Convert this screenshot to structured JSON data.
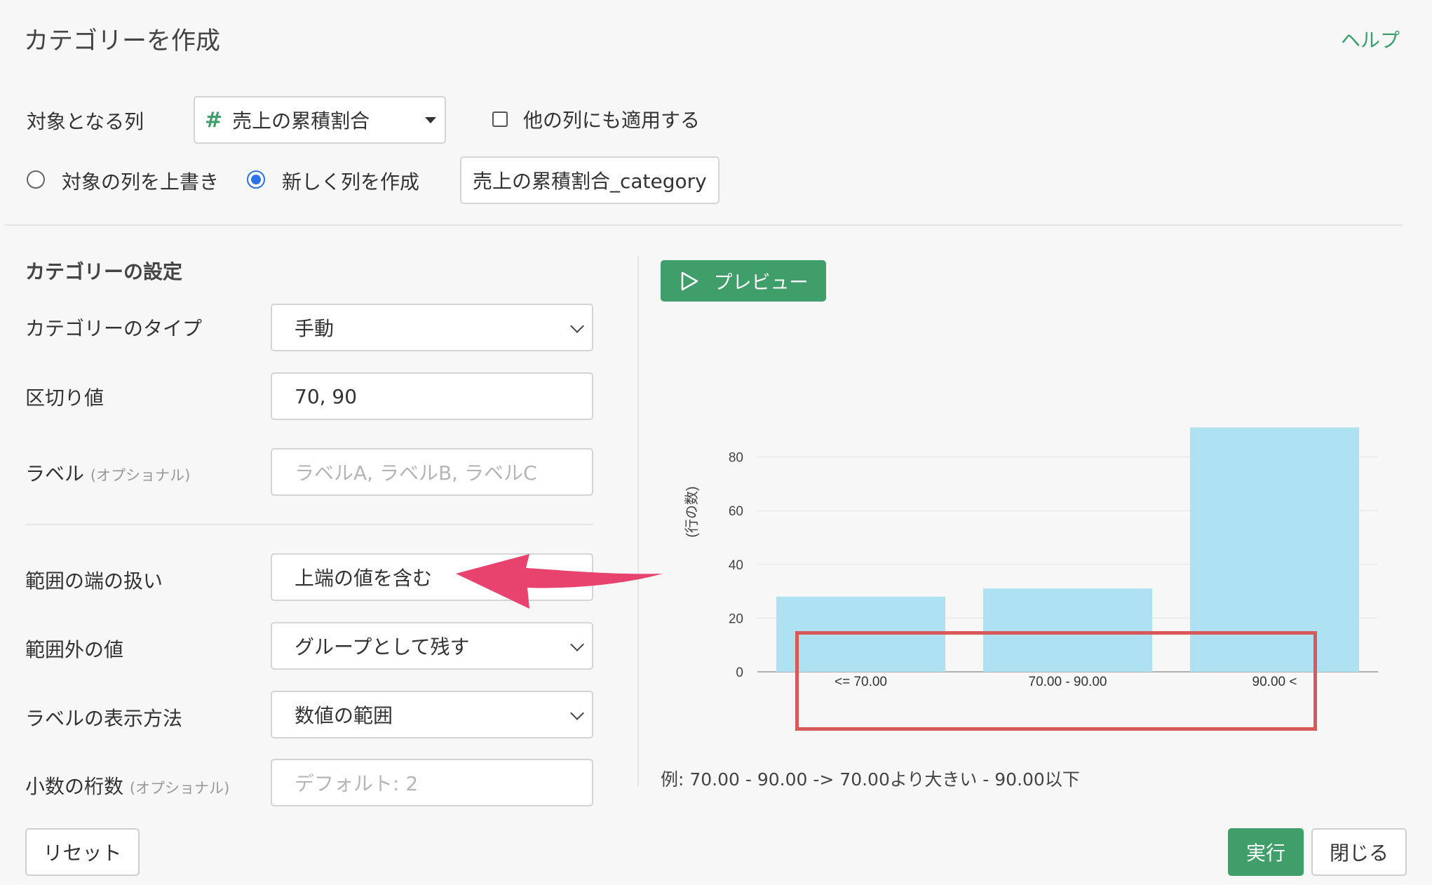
{
  "header": {
    "title": "カテゴリーを作成",
    "help": "ヘルプ"
  },
  "target": {
    "label": "対象となる列",
    "column_icon": "#",
    "column_value": "売上の累積割合",
    "apply_other_label": "他の列にも適用する",
    "overwrite_label": "対象の列を上書き",
    "new_column_label": "新しく列を作成",
    "new_column_name": "売上の累積割合_category"
  },
  "settings": {
    "heading": "カテゴリーの設定",
    "type_label": "カテゴリーのタイプ",
    "type_value": "手動",
    "breaks_label": "区切り値",
    "breaks_value": "70, 90",
    "labels_label": "ラベル",
    "optional": "(オプショナル)",
    "labels_placeholder": "ラベルA, ラベルB, ラベルC",
    "edge_label": "範囲の端の扱い",
    "edge_value": "上端の値を含む",
    "outside_label": "範囲外の値",
    "outside_value": "グループとして残す",
    "display_label": "ラベルの表示方法",
    "display_value": "数値の範囲",
    "decimals_label": "小数の桁数",
    "decimals_placeholder": "デフォルト: 2"
  },
  "preview": {
    "button": "プレビュー"
  },
  "chart_data": {
    "type": "bar",
    "categories": [
      "<= 70.00",
      "70.00 - 90.00",
      "90.00 <"
    ],
    "values": [
      28,
      31,
      91
    ],
    "ylabel": "(行の数)",
    "yticks": [
      0,
      20,
      40,
      60,
      80
    ],
    "ylim": [
      0,
      95
    ],
    "grid": true,
    "bar_color": "#aee1f2"
  },
  "example_note": "例: 70.00 - 90.00 -> 70.00より大きい - 90.00以下",
  "footer": {
    "reset": "リセット",
    "run": "実行",
    "close": "閉じる"
  },
  "colors": {
    "accent": "#3f9e6a",
    "arrow": "#e8436e",
    "highlight": "#d9595a",
    "radio": "#2a73e8"
  }
}
